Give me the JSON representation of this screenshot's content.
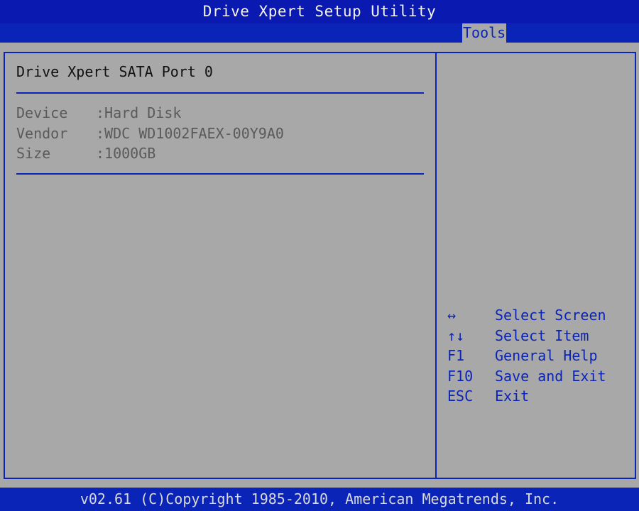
{
  "window": {
    "title": "Drive Xpert Setup Utility"
  },
  "menu": {
    "active_tab": "Tools"
  },
  "section": {
    "title": "Drive Xpert SATA Port 0",
    "rows": [
      {
        "label": "Device",
        "value": ":Hard Disk"
      },
      {
        "label": "Vendor",
        "value": ":WDC WD1002FAEX-00Y9A0"
      },
      {
        "label": "Size",
        "value": ":1000GB"
      }
    ]
  },
  "help": [
    {
      "key": "↔",
      "action": "Select Screen"
    },
    {
      "key": "↑↓",
      "action": "Select Item"
    },
    {
      "key": "F1",
      "action": "General Help"
    },
    {
      "key": "F10",
      "action": "Save and Exit"
    },
    {
      "key": "ESC",
      "action": "Exit"
    }
  ],
  "footer": {
    "text": "v02.61 (C)Copyright 1985-2010, American Megatrends, Inc."
  },
  "colors": {
    "bar_blue": "#0a24b8",
    "panel_gray": "#a8a8a8",
    "text_dim": "#5a5a5a"
  }
}
